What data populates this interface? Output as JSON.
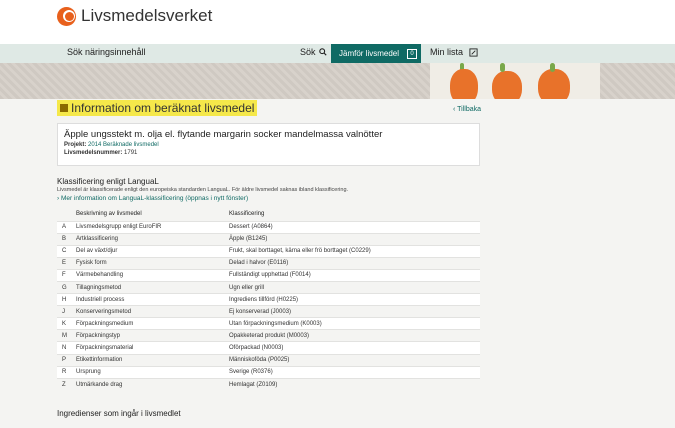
{
  "brand": {
    "name": "Livsmedelsverket",
    "accent": "#e8601c",
    "teal": "#0f6a64"
  },
  "nav": {
    "search_label": "Sök näringsinnehåll",
    "sok_label": "Sök",
    "compare_label": "Jämför livsmedel",
    "compare_count": "0",
    "list_label": "Min lista"
  },
  "page": {
    "heading": "Information om beräknat livsmedel",
    "back_label": "Tillbaka"
  },
  "food": {
    "title": "Äpple ungsstekt m. olja el. flytande margarin socker mandelmassa valnötter",
    "project_label": "Projekt:",
    "project_value": "2014 Beräknade livsmedel",
    "number_label": "Livsmedelsnummer:",
    "number_value": "1791"
  },
  "classification": {
    "title": "Klassificering enligt LanguaL",
    "description": "Livsmedel är klassificerade enligt den europeiska standarden LanguaL. För äldre livsmedel saknas ibland klassificering.",
    "link": "Mer information om LanguaL-klassificering (öppnas i nytt fönster)",
    "columns": [
      "Beskrivning av livsmedel",
      "Klassificering"
    ],
    "rows": [
      {
        "code": "A",
        "desc": "Livsmedelsgrupp enligt EuroFIR",
        "value": "Dessert (A0864)"
      },
      {
        "code": "B",
        "desc": "Artklassificering",
        "value": "Äpple (B1245)"
      },
      {
        "code": "C",
        "desc": "Del av växt/djur",
        "value": "Frukt, skal borttaget, kärna eller frö borttaget (C0229)"
      },
      {
        "code": "E",
        "desc": "Fysisk form",
        "value": "Delad i halvor (E0116)"
      },
      {
        "code": "F",
        "desc": "Värmebehandling",
        "value": "Fullständigt upphettad (F0014)"
      },
      {
        "code": "G",
        "desc": "Tillagningsmetod",
        "value": "Ugn eller grill"
      },
      {
        "code": "H",
        "desc": "Industriell process",
        "value": "Ingrediens tillförd (H0225)"
      },
      {
        "code": "J",
        "desc": "Konserveringsmetod",
        "value": "Ej konserverad (J0003)"
      },
      {
        "code": "K",
        "desc": "Förpackningsmedium",
        "value": "Utan förpackningsmedium (K0003)"
      },
      {
        "code": "M",
        "desc": "Förpackningstyp",
        "value": "Opakketerad produkt (M0003)"
      },
      {
        "code": "N",
        "desc": "Förpackningsmaterial",
        "value": "Oförpackad (N0003)"
      },
      {
        "code": "P",
        "desc": "Etikettinformation",
        "value": "Människoföda (P0025)"
      },
      {
        "code": "R",
        "desc": "Ursprung",
        "value": "Sverige (R0376)"
      },
      {
        "code": "Z",
        "desc": "Utmärkande drag",
        "value": "Hemlagat (Z0109)"
      }
    ]
  },
  "ingredients": {
    "title": "Ingredienser som ingår i livsmedlet"
  }
}
